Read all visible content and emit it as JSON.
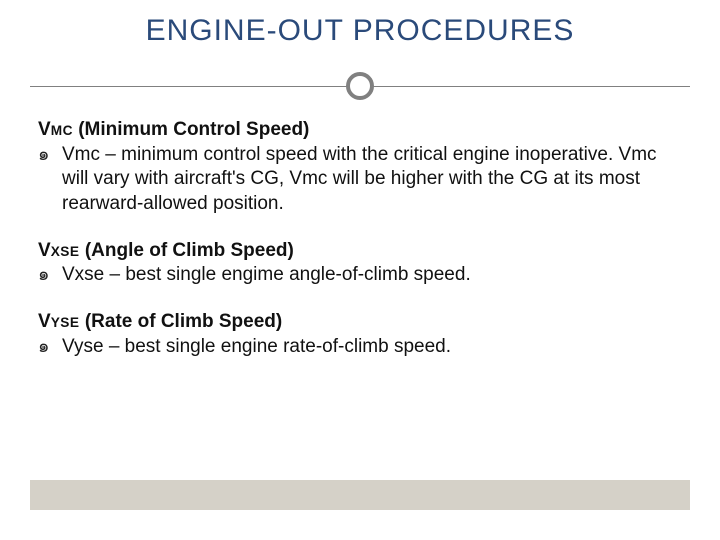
{
  "title": "ENGINE-OUT PROCEDURES",
  "sections": [
    {
      "head_prefix": "V",
      "head_sub": "MC",
      "head_rest": " (Minimum Control Speed)",
      "bullet": "Vmc – minimum control speed with the critical engine inoperative.  Vmc will vary with aircraft's CG, Vmc will be higher with the CG at its most rearward-allowed position."
    },
    {
      "head_prefix": "V",
      "head_sub": "XSE",
      "head_rest": " (Angle of Climb Speed)",
      "bullet": "Vxse – best single engime angle-of-climb speed."
    },
    {
      "head_prefix": "V",
      "head_sub": "YSE",
      "head_rest": " (Rate of Climb Speed)",
      "bullet": "Vyse – best single engine rate-of-climb speed."
    }
  ],
  "bullet_marker": "๑"
}
